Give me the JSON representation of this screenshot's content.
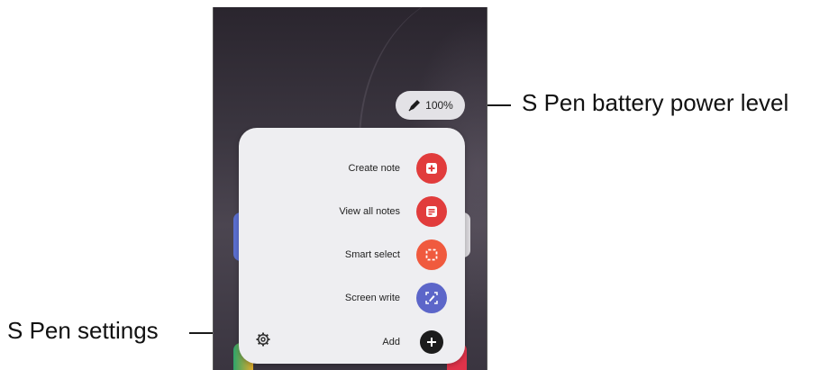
{
  "callouts": {
    "battery": "S Pen battery power level",
    "settings": "S Pen settings"
  },
  "battery": {
    "level": "100%",
    "icon": "pen-icon"
  },
  "menu": {
    "items": [
      {
        "label": "Create note",
        "icon": "create-note-icon",
        "color": "#e13c3c"
      },
      {
        "label": "View all notes",
        "icon": "view-notes-icon",
        "color": "#e13c3c"
      },
      {
        "label": "Smart select",
        "icon": "smart-select-icon",
        "color": "#f05a3e"
      },
      {
        "label": "Screen write",
        "icon": "screen-write-icon",
        "color": "#5c66c9"
      },
      {
        "label": "Add",
        "icon": "plus-icon",
        "color": "#1c1c1c"
      }
    ],
    "settings_icon": "gear-icon"
  }
}
